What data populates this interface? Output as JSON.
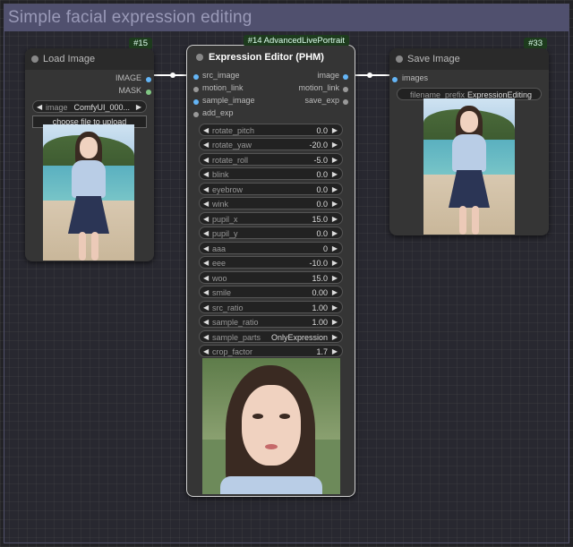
{
  "group": {
    "title": "Simple facial expression editing"
  },
  "load_node": {
    "id": "#15",
    "title": "Load Image",
    "outputs": [
      "IMAGE",
      "MASK"
    ],
    "image_widget": {
      "label": "image",
      "value": "ComfyUI_000..."
    },
    "upload_label": "choose file to upload"
  },
  "editor_node": {
    "id": "#14 AdvancedLivePortrait",
    "title": "Expression Editor (PHM)",
    "inputs": [
      "src_image",
      "motion_link",
      "sample_image",
      "add_exp"
    ],
    "outputs": [
      "image",
      "motion_link",
      "save_exp"
    ],
    "params": [
      {
        "label": "rotate_pitch",
        "value": "0.0"
      },
      {
        "label": "rotate_yaw",
        "value": "-20.0"
      },
      {
        "label": "rotate_roll",
        "value": "-5.0"
      },
      {
        "label": "blink",
        "value": "0.0"
      },
      {
        "label": "eyebrow",
        "value": "0.0"
      },
      {
        "label": "wink",
        "value": "0.0"
      },
      {
        "label": "pupil_x",
        "value": "15.0"
      },
      {
        "label": "pupil_y",
        "value": "0.0"
      },
      {
        "label": "aaa",
        "value": "0"
      },
      {
        "label": "eee",
        "value": "-10.0"
      },
      {
        "label": "woo",
        "value": "15.0"
      },
      {
        "label": "smile",
        "value": "0.00"
      },
      {
        "label": "src_ratio",
        "value": "1.00"
      },
      {
        "label": "sample_ratio",
        "value": "1.00"
      },
      {
        "label": "sample_parts",
        "value": "OnlyExpression"
      },
      {
        "label": "crop_factor",
        "value": "1.7"
      }
    ]
  },
  "save_node": {
    "id": "#33",
    "title": "Save Image",
    "inputs": [
      "images"
    ],
    "prefix_widget": {
      "label": "filename_prefix",
      "value": "ExpressionEditing"
    }
  },
  "colors": {
    "image_slot": "#64b5f6",
    "mask_slot": "#81c784",
    "link": "#ffffff",
    "badge": "#1d3b1d"
  }
}
